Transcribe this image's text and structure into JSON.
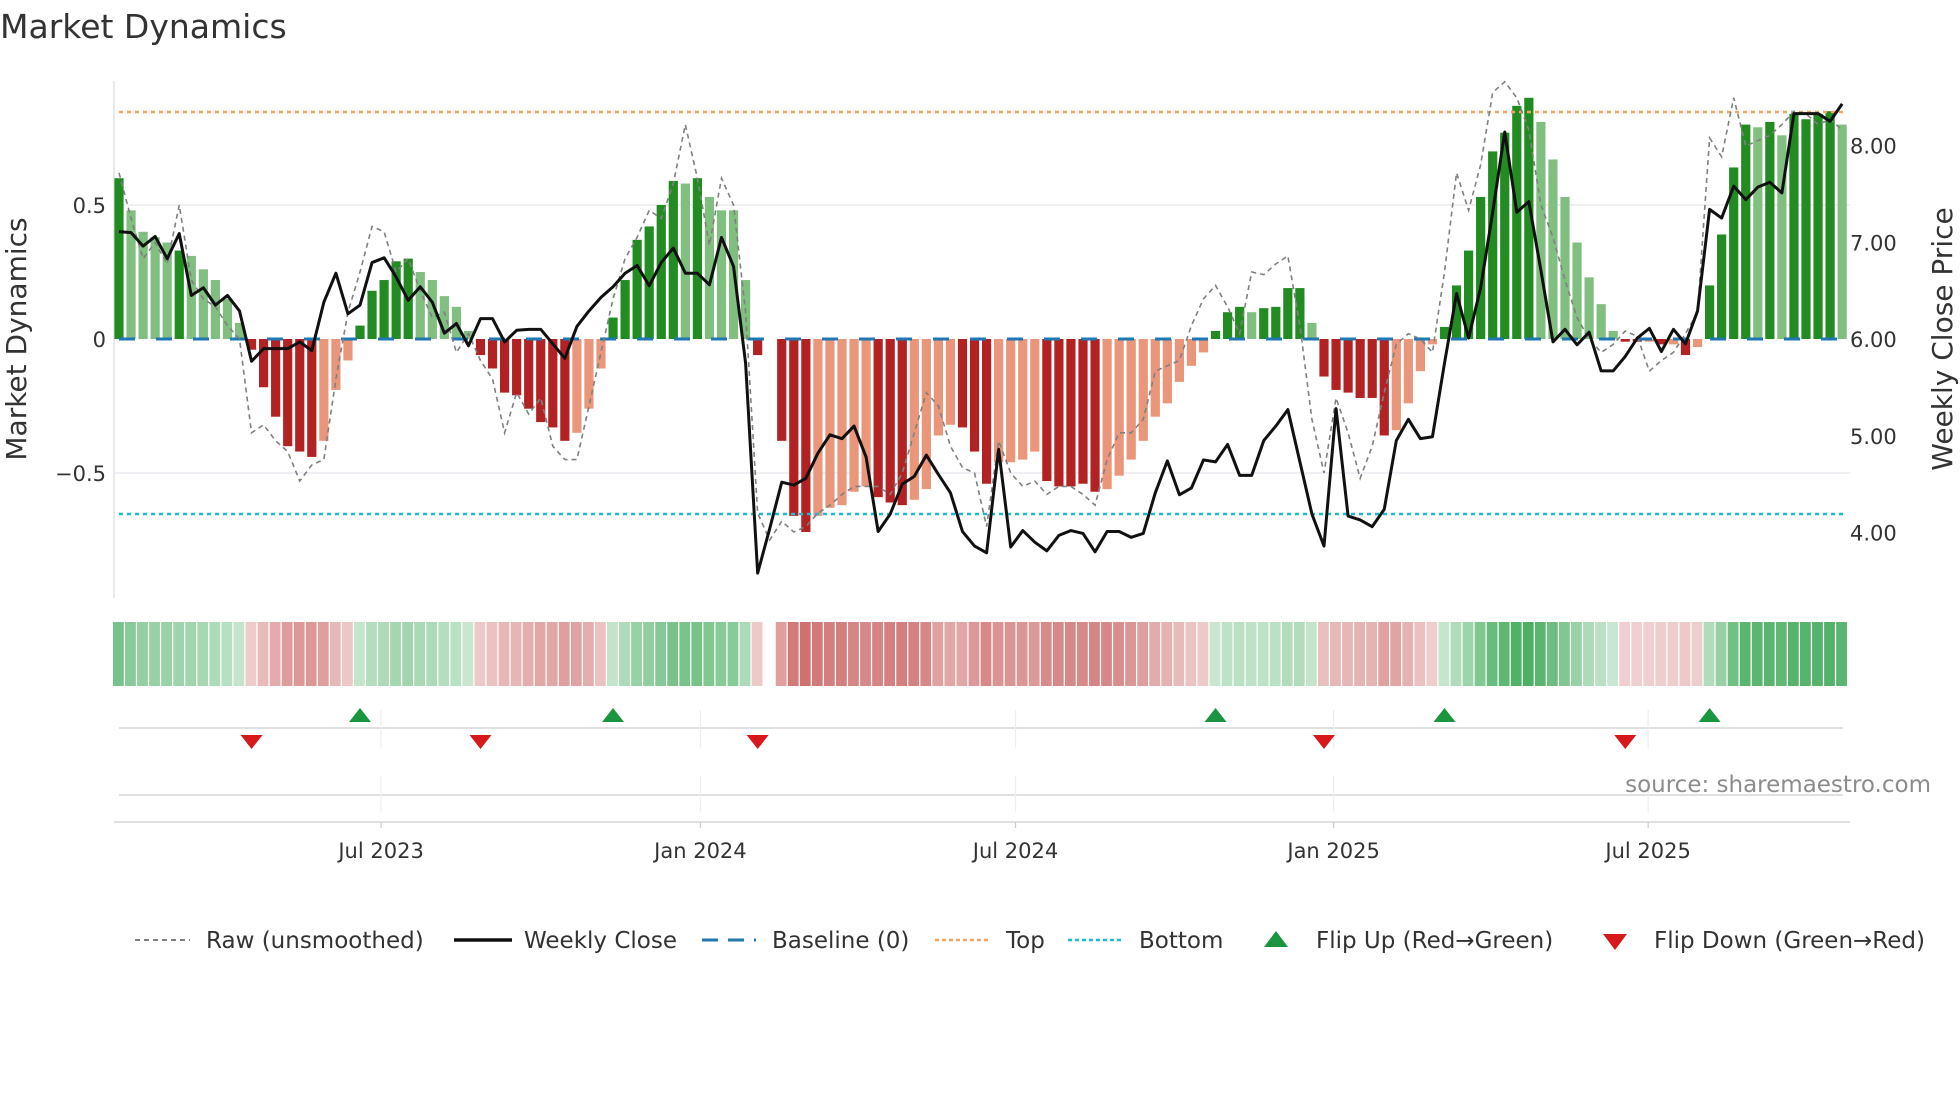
{
  "chart_data": {
    "type": "bar",
    "title": "Market Dynamics",
    "ylabel": "Market Dynamics",
    "y2label": "Weekly Close Price",
    "ylim": [
      -0.98,
      0.96
    ],
    "y2lim": [
      3.3,
      8.8
    ],
    "yticks": [
      {
        "v": 0.5,
        "label": "0.5"
      },
      {
        "v": 0,
        "label": "0"
      },
      {
        "v": -0.5,
        "label": "−0.5"
      }
    ],
    "y2ticks": [
      {
        "v": 8,
        "label": "8.00"
      },
      {
        "v": 7,
        "label": "7.00"
      },
      {
        "v": 6,
        "label": "6.00"
      },
      {
        "v": 5,
        "label": "5.00"
      },
      {
        "v": 4,
        "label": "4.00"
      }
    ],
    "xticks": [
      {
        "week": 21.75,
        "label": "Jul 2023"
      },
      {
        "week": 48.25,
        "label": "Jan 2024"
      },
      {
        "week": 74.4,
        "label": "Jul 2024"
      },
      {
        "week": 100.8,
        "label": "Jan 2025"
      },
      {
        "week": 126.9,
        "label": "Jul 2025"
      }
    ],
    "top_level": 0.847,
    "bottom_level": -0.653,
    "baseline": 0,
    "values": [
      0.6,
      0.48,
      0.4,
      0.38,
      0.36,
      0.33,
      0.31,
      0.26,
      0.22,
      0.15,
      0.06,
      -0.04,
      -0.18,
      -0.29,
      -0.4,
      -0.42,
      -0.44,
      -0.38,
      -0.19,
      -0.08,
      0.05,
      0.18,
      0.22,
      0.29,
      0.3,
      0.25,
      0.22,
      0.16,
      0.12,
      0.03,
      -0.06,
      -0.11,
      -0.2,
      -0.21,
      -0.26,
      -0.31,
      -0.33,
      -0.38,
      -0.35,
      -0.26,
      -0.11,
      0.08,
      0.22,
      0.37,
      0.42,
      0.5,
      0.59,
      0.58,
      0.6,
      0.53,
      0.48,
      0.48,
      0.22,
      -0.06,
      0,
      -0.38,
      -0.66,
      -0.72,
      -0.66,
      -0.63,
      -0.62,
      -0.57,
      -0.55,
      -0.59,
      -0.61,
      -0.62,
      -0.6,
      -0.56,
      -0.36,
      -0.32,
      -0.33,
      -0.42,
      -0.54,
      -0.46,
      -0.46,
      -0.45,
      -0.42,
      -0.53,
      -0.55,
      -0.55,
      -0.54,
      -0.57,
      -0.56,
      -0.51,
      -0.45,
      -0.38,
      -0.29,
      -0.24,
      -0.16,
      -0.1,
      -0.05,
      0.03,
      0.1,
      0.12,
      0.1,
      0.115,
      0.12,
      0.19,
      0.19,
      0.06,
      -0.14,
      -0.19,
      -0.2,
      -0.22,
      -0.22,
      -0.36,
      -0.34,
      -0.24,
      -0.12,
      -0.02,
      0.045,
      0.2,
      0.33,
      0.53,
      0.7,
      0.77,
      0.87,
      0.9,
      0.81,
      0.67,
      0.53,
      0.36,
      0.23,
      0.13,
      0.03,
      -0.01,
      -0.01,
      -0.01,
      -0.02,
      -0.02,
      -0.06,
      -0.03,
      0.2,
      0.39,
      0.64,
      0.8,
      0.79,
      0.81,
      0.76,
      0.84,
      0.82,
      0.84,
      0.85,
      0.8
    ],
    "strong": [
      1,
      0,
      0,
      0,
      0,
      1,
      0,
      0,
      0,
      0,
      0,
      1,
      1,
      1,
      1,
      1,
      1,
      0,
      0,
      0,
      1,
      1,
      1,
      1,
      1,
      0,
      0,
      0,
      0,
      0,
      1,
      1,
      1,
      1,
      1,
      1,
      1,
      1,
      0,
      0,
      0,
      1,
      1,
      1,
      1,
      1,
      1,
      0,
      1,
      0,
      0,
      0,
      0,
      1,
      0,
      1,
      1,
      1,
      0,
      0,
      0,
      0,
      0,
      1,
      1,
      1,
      0,
      0,
      0,
      0,
      1,
      1,
      1,
      0,
      0,
      0,
      0,
      1,
      1,
      1,
      1,
      1,
      0,
      0,
      0,
      0,
      0,
      0,
      0,
      0,
      0,
      1,
      1,
      1,
      0,
      1,
      1,
      1,
      1,
      0,
      1,
      1,
      1,
      1,
      1,
      1,
      0,
      0,
      0,
      0,
      1,
      1,
      1,
      1,
      1,
      1,
      1,
      1,
      0,
      0,
      0,
      0,
      0,
      0,
      0,
      1,
      1,
      0,
      1,
      0,
      1,
      0,
      1,
      1,
      1,
      1,
      0,
      1,
      0,
      1,
      1,
      1,
      1,
      0
    ],
    "raw": [
      0.62,
      0.45,
      0.3,
      0.36,
      0.28,
      0.5,
      0.22,
      0.15,
      0.12,
      0.05,
      0.0,
      -0.35,
      -0.32,
      -0.38,
      -0.42,
      -0.53,
      -0.47,
      -0.45,
      -0.15,
      0.1,
      0.25,
      0.42,
      0.4,
      0.25,
      0.3,
      0.18,
      0.08,
      0.1,
      -0.05,
      0.02,
      -0.08,
      -0.15,
      -0.35,
      -0.2,
      -0.28,
      -0.22,
      -0.4,
      -0.45,
      -0.45,
      -0.25,
      -0.05,
      0.15,
      0.3,
      0.38,
      0.48,
      0.45,
      0.58,
      0.8,
      0.6,
      0.35,
      0.6,
      0.5,
      0.1,
      -0.65,
      -0.75,
      -0.68,
      -0.72,
      -0.7,
      -0.65,
      -0.62,
      -0.58,
      -0.55,
      -0.55,
      -0.55,
      -0.58,
      -0.5,
      -0.35,
      -0.2,
      -0.25,
      -0.4,
      -0.48,
      -0.5,
      -0.7,
      -0.38,
      -0.5,
      -0.55,
      -0.53,
      -0.58,
      -0.55,
      -0.55,
      -0.58,
      -0.62,
      -0.45,
      -0.35,
      -0.35,
      -0.3,
      -0.12,
      -0.1,
      -0.08,
      0.05,
      0.15,
      0.2,
      0.12,
      0.02,
      0.25,
      0.24,
      0.28,
      0.31,
      0.05,
      -0.3,
      -0.5,
      -0.22,
      -0.35,
      -0.52,
      -0.4,
      -0.2,
      -0.02,
      0.02,
      0.0,
      -0.05,
      0.25,
      0.62,
      0.48,
      0.65,
      0.92,
      0.96,
      0.9,
      0.78,
      0.5,
      0.38,
      0.22,
      0.08,
      0.0,
      -0.05,
      -0.02,
      0.03,
      0.01,
      -0.12,
      -0.08,
      -0.05,
      0.02,
      0.1,
      0.75,
      0.68,
      0.9,
      0.72,
      0.74,
      0.76,
      0.8,
      0.85,
      0.84,
      0.8,
      0.82,
      0.78
    ],
    "close": [
      7.11,
      7.1,
      6.96,
      7.06,
      6.83,
      7.09,
      6.45,
      6.53,
      6.35,
      6.45,
      6.29,
      5.77,
      5.9,
      5.9,
      5.9,
      5.97,
      5.88,
      6.38,
      6.68,
      6.26,
      6.35,
      6.79,
      6.84,
      6.64,
      6.4,
      6.54,
      6.38,
      6.06,
      6.16,
      5.93,
      6.21,
      6.21,
      5.97,
      6.09,
      6.1,
      6.1,
      5.95,
      5.8,
      6.13,
      6.29,
      6.43,
      6.54,
      6.68,
      6.76,
      6.55,
      6.79,
      6.94,
      6.68,
      6.68,
      6.56,
      7.05,
      6.75,
      5.75,
      3.58,
      4.04,
      4.52,
      4.49,
      4.56,
      4.82,
      5.01,
      4.97,
      5.1,
      4.78,
      4.01,
      4.19,
      4.5,
      4.58,
      4.8,
      4.6,
      4.41,
      4.01,
      3.86,
      3.79,
      4.86,
      3.85,
      4.02,
      3.9,
      3.81,
      3.97,
      4.02,
      3.99,
      3.8,
      4.01,
      4.01,
      3.95,
      3.99,
      4.41,
      4.74,
      4.39,
      4.46,
      4.75,
      4.73,
      4.91,
      4.59,
      4.59,
      4.95,
      5.1,
      5.27,
      4.73,
      4.19,
      3.86,
      5.28,
      4.17,
      4.13,
      4.06,
      4.24,
      4.95,
      5.17,
      4.97,
      4.99,
      5.75,
      6.47,
      6.01,
      6.53,
      7.31,
      8.14,
      7.31,
      7.42,
      6.71,
      5.97,
      6.1,
      5.94,
      6.07,
      5.67,
      5.67,
      5.82,
      6.01,
      6.11,
      5.87,
      6.1,
      5.95,
      6.29,
      7.34,
      7.25,
      7.58,
      7.44,
      7.57,
      7.62,
      7.51,
      8.33,
      8.33,
      8.33,
      8.25,
      8.43
    ],
    "strip_gap_weeks": [
      54
    ],
    "flip_up_weeks": [
      20,
      41,
      91,
      110,
      132
    ],
    "flip_down_weeks": [
      11,
      30,
      53,
      100,
      125
    ],
    "legend": {
      "raw": "Raw (unsmoothed)",
      "close": "Weekly Close",
      "baseline": "Baseline (0)",
      "top": "Top",
      "bottom": "Bottom",
      "flip_up": "Flip Up (Red→Green)",
      "flip_down": "Flip Down (Green→Red)"
    },
    "legend_placement": "bottom",
    "source": "source: sharemaestro.com",
    "colors": {
      "strong_up": "#228b22",
      "weak_up": "#80bf80",
      "strong_down": "#b22222",
      "weak_down": "#e9967a",
      "close": "#111111",
      "raw": "#808080",
      "baseline": "#1f77b4",
      "top": "#f4a460",
      "bottom": "#17becf",
      "flip_up": "#1a9641",
      "flip_down": "#d7191c",
      "strip_up": "#4caf64",
      "strip_down": "#c85a5a"
    }
  }
}
